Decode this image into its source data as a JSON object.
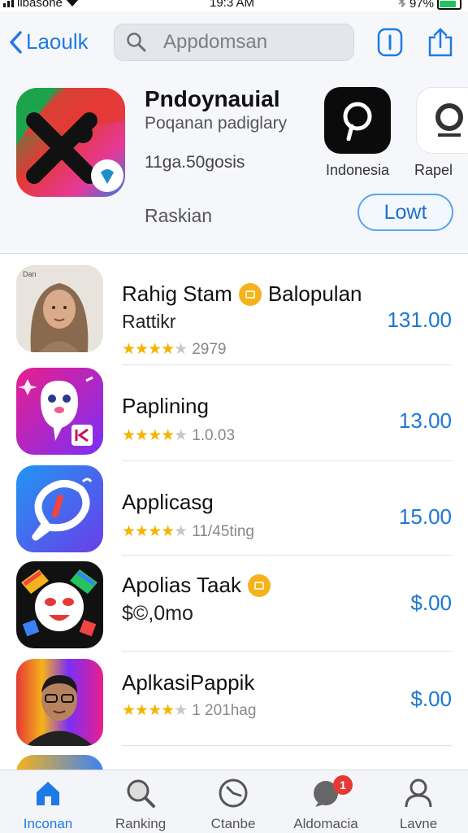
{
  "status_bar": {
    "carrier": "ilbasone",
    "time": "19:3 AM",
    "battery": "97%"
  },
  "nav": {
    "back_label": "Laoulk",
    "search_placeholder": "Appdomsan"
  },
  "featured": {
    "title": "Pndoynauial",
    "subtitle": "Poqanan padiglary",
    "stat": "11ga.50gosis",
    "rank": "Raskian",
    "button_label": "Lowt",
    "side_apps": [
      {
        "label": "Indonesia"
      },
      {
        "label": "Rapel"
      }
    ]
  },
  "apps": [
    {
      "name": "Rahig Stam",
      "badge_text": "Balopulan",
      "subtitle": "Rattikr",
      "rating": "2979",
      "stars": 4,
      "price": "131.00",
      "icon": "portrait-woman-icon",
      "avatar_label": "Dan"
    },
    {
      "name": "Paplining",
      "rating": "1.0.03",
      "stars": 4,
      "price": "13.00",
      "icon": "mascot-icon"
    },
    {
      "name": "Applicasg",
      "rating": "11/45ting",
      "stars": 4,
      "price": "15.00",
      "icon": "chat-logo-icon"
    },
    {
      "name": "Apolias Taak",
      "subtitle": "$©,0mo",
      "price": "$.00",
      "icon": "game-face-icon",
      "has_badge": true
    },
    {
      "name": "AplkasiPappik",
      "rating": "1 201hag",
      "stars": 4,
      "price": "$.00",
      "icon": "portrait-man-icon"
    }
  ],
  "tabs": [
    {
      "label": "Inconan",
      "icon": "home-icon",
      "active": true
    },
    {
      "label": "Ranking",
      "icon": "search-icon"
    },
    {
      "label": "Ctanbe",
      "icon": "clock-icon"
    },
    {
      "label": "Aldomacia",
      "icon": "chat-icon",
      "badge": "1"
    },
    {
      "label": "Lavne",
      "icon": "person-icon"
    }
  ],
  "colors": {
    "accent": "#1e7ae6",
    "price": "#1c77d4",
    "star": "#f4b400",
    "badge": "#f5b21c"
  }
}
